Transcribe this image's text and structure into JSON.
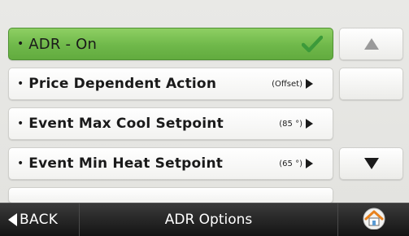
{
  "menu": {
    "items": [
      {
        "label": "ADR - On",
        "value": "",
        "selected": true,
        "icon": "check-icon"
      },
      {
        "label": "Price Dependent Action",
        "value": "(Offset)",
        "selected": false,
        "icon": "arrow-right-icon"
      },
      {
        "label": "Event Max Cool Setpoint",
        "value": "(85 °)",
        "selected": false,
        "icon": "arrow-right-icon"
      },
      {
        "label": "Event Min Heat Setpoint",
        "value": "(65 °)",
        "selected": false,
        "icon": "arrow-right-icon"
      }
    ]
  },
  "scroll": {
    "up_icon": "arrow-up-icon",
    "down_icon": "arrow-down-icon"
  },
  "bottom_bar": {
    "back_label": "BACK",
    "title": "ADR Options",
    "home_icon": "home-icon"
  },
  "colors": {
    "selected": "#6fb84a",
    "check": "#3c9a3a",
    "bar": "#1e1e1e",
    "home_roof": "#e8821e"
  }
}
